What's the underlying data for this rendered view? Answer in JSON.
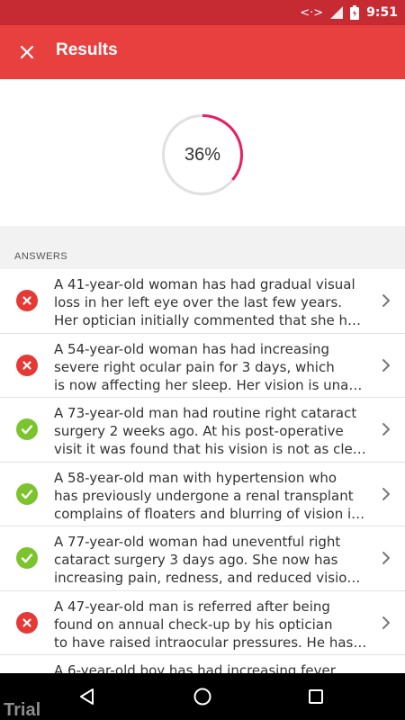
{
  "status_bar": {
    "time": "9:51",
    "icons": [
      "data-sync-icon",
      "signal-icon",
      "battery-icon"
    ]
  },
  "app_bar": {
    "title": "Results",
    "close_icon": "close-icon"
  },
  "score": {
    "label": "36%",
    "fraction": 0.36,
    "accent_color": "#e91e63",
    "track_color": "#e0e0e0"
  },
  "answers": {
    "header": "ANSWERS",
    "items": [
      {
        "correct": false,
        "lines": [
          "A 41-year-old woman has had gradual visual",
          "loss in her left eye over the last few years.",
          "Her optician initially commented that she h…"
        ]
      },
      {
        "correct": false,
        "lines": [
          "A 54-year-old woman has had increasing",
          "severe right ocular pain for 3 days, which",
          "is now affecting her sleep. Her vision is una…"
        ]
      },
      {
        "correct": true,
        "lines": [
          "A 73-year-old man had routine right cataract",
          "surgery 2 weeks ago. At his post-operative",
          "visit it was found that his vision is not as cle…"
        ]
      },
      {
        "correct": true,
        "lines": [
          "A 58-year-old man with hypertension who",
          "has previously undergone a renal transplant",
          "complains of floaters and blurring of vision i…"
        ]
      },
      {
        "correct": true,
        "lines": [
          "A 77-year-old woman had uneventful right",
          "cataract surgery 3 days ago. She now has",
          "increasing pain, redness, and reduced visio…"
        ]
      },
      {
        "correct": false,
        "lines": [
          "A 47-year-old man is referred after being",
          "found on annual check-up by his optician",
          "to have raised intraocular pressures. He has…"
        ]
      },
      {
        "correct": false,
        "lines": [
          "A 6-year-old boy has had increasing fever",
          "",
          ""
        ]
      }
    ]
  },
  "colors": {
    "app_bar": "#e8403f",
    "status_bar": "#c62a33",
    "incorrect": "#e53935",
    "correct": "#7cc42d"
  },
  "nav_bar": {
    "buttons": [
      "back-icon",
      "home-icon",
      "recents-icon"
    ]
  },
  "watermark": "Trial"
}
